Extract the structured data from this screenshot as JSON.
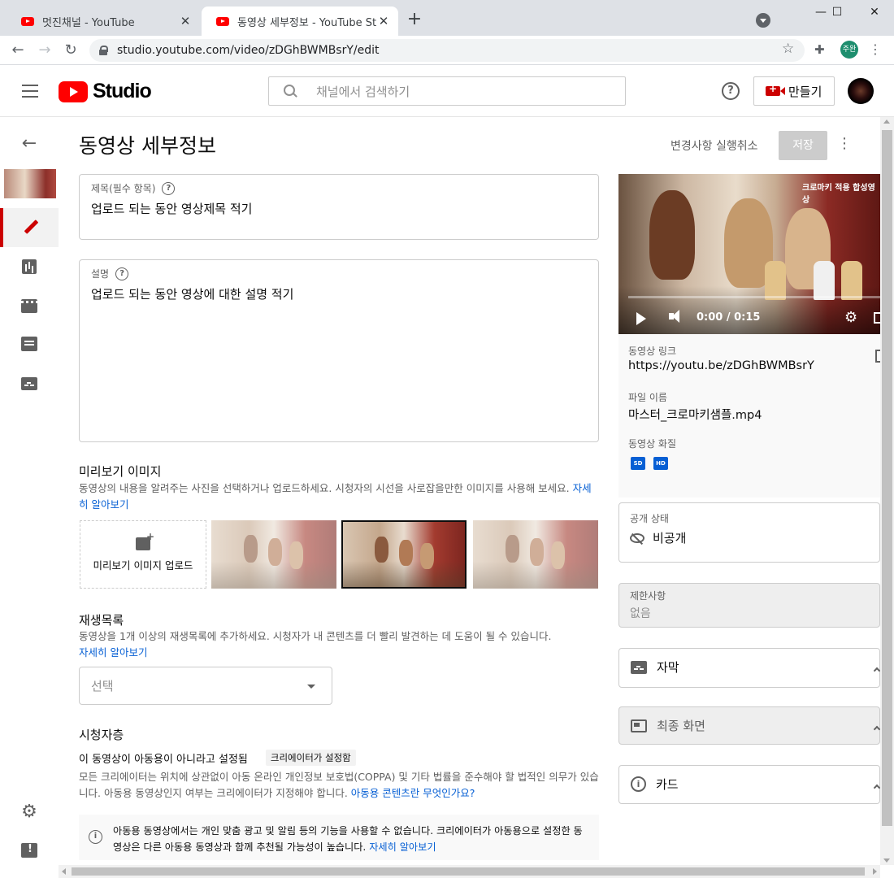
{
  "browser": {
    "tabs": [
      {
        "title": "멋진채널 - YouTube",
        "active": false
      },
      {
        "title": "동영상 세부정보 - YouTube Studio",
        "active": true
      }
    ],
    "new_tab_glyph": "+",
    "close_glyph": "✕",
    "window_controls": {
      "minimize": "—",
      "maximize": "☐",
      "close": "✕"
    },
    "url": "studio.youtube.com/video/zDGhBWMBsrY/edit",
    "profile_initials": "주완",
    "nav": {
      "back": "←",
      "forward": "→",
      "reload": "↻"
    }
  },
  "header": {
    "logo_text": "Studio",
    "search_placeholder": "채널에서 검색하기",
    "help_glyph": "?",
    "create_label": "만들기"
  },
  "rail": {
    "icons": [
      "back-arrow-icon",
      "video-thumbnail",
      "pencil-icon",
      "analytics-icon",
      "editor-icon",
      "comments-icon",
      "subtitles-icon",
      "gear-icon",
      "feedback-icon"
    ],
    "back_glyph": "←",
    "gear_glyph": "⚙"
  },
  "page": {
    "title": "동영상 세부정보",
    "undo_label": "변경사항 실행취소",
    "save_label": "저장",
    "kebab_glyph": "⋮"
  },
  "title_field": {
    "label": "제목(필수 항목)",
    "value": "업로드 되는 동안 영상제목 적기"
  },
  "description_field": {
    "label": "설명",
    "value": "업로드 되는 동안 영상에 대한 설명 적기"
  },
  "thumbnail": {
    "heading": "미리보기 이미지",
    "description": "동영상의 내용을 알려주는 사진을 선택하거나 업로드하세요. 시청자의 시선을 사로잡을만한 이미지를 사용해 보세요.",
    "learn_more": "자세히 알아보기",
    "upload_label": "미리보기 이미지 업로드",
    "options_count": 3,
    "selected_index": 1
  },
  "playlist": {
    "heading": "재생목록",
    "description": "동영상을 1개 이상의 재생목록에 추가하세요. 시청자가 내 콘텐츠를 더 빨리 발견하는 데 도움이 될 수 있습니다.",
    "learn_more": "자세히 알아보기",
    "select_placeholder": "선택"
  },
  "audience": {
    "heading": "시청자층",
    "status": "이 동영상이 아동용이 아니라고 설정됨",
    "set_by_chip": "크리에이터가 설정함",
    "coppa_text": "모든 크리에이터는 위치에 상관없이 아동 온라인 개인정보 보호법(COPPA) 및 기타 법률을 준수해야 할 법적인 의무가 있습니다. 아동용 동영상인지 여부는 크리에이터가 지정해야 합니다.",
    "coppa_link": "아동용 콘텐츠란 무엇인가요?",
    "info_text": "아동용 동영상에서는 개인 맞춤 광고 및 알림 등의 기능을 사용할 수 없습니다. 크리에이터가 아동용으로 설정한 동영상은 다른 아동용 동영상과 함께 추천될 가능성이 높습니다.",
    "info_link": "자세히 알아보기",
    "info_glyph": "i"
  },
  "video_panel": {
    "watermark": "크로마키 적용 합성영상",
    "time": "0:00 / 0:15",
    "progress": 0,
    "link_label": "동영상 링크",
    "link_value": "https://youtu.be/zDGhBWMBsrY",
    "filename_label": "파일 이름",
    "filename_value": "마스터_크로마키샘플.mp4",
    "quality_label": "동영상 화질",
    "quality_badges": [
      "SD",
      "HD"
    ]
  },
  "visibility": {
    "label": "공개 상태",
    "value": "비공개"
  },
  "restrictions": {
    "label": "제한사항",
    "value": "없음"
  },
  "accordions": {
    "subtitles": "자막",
    "end_screen": "최종 화면",
    "cards": "카드",
    "cards_glyph": "i"
  }
}
